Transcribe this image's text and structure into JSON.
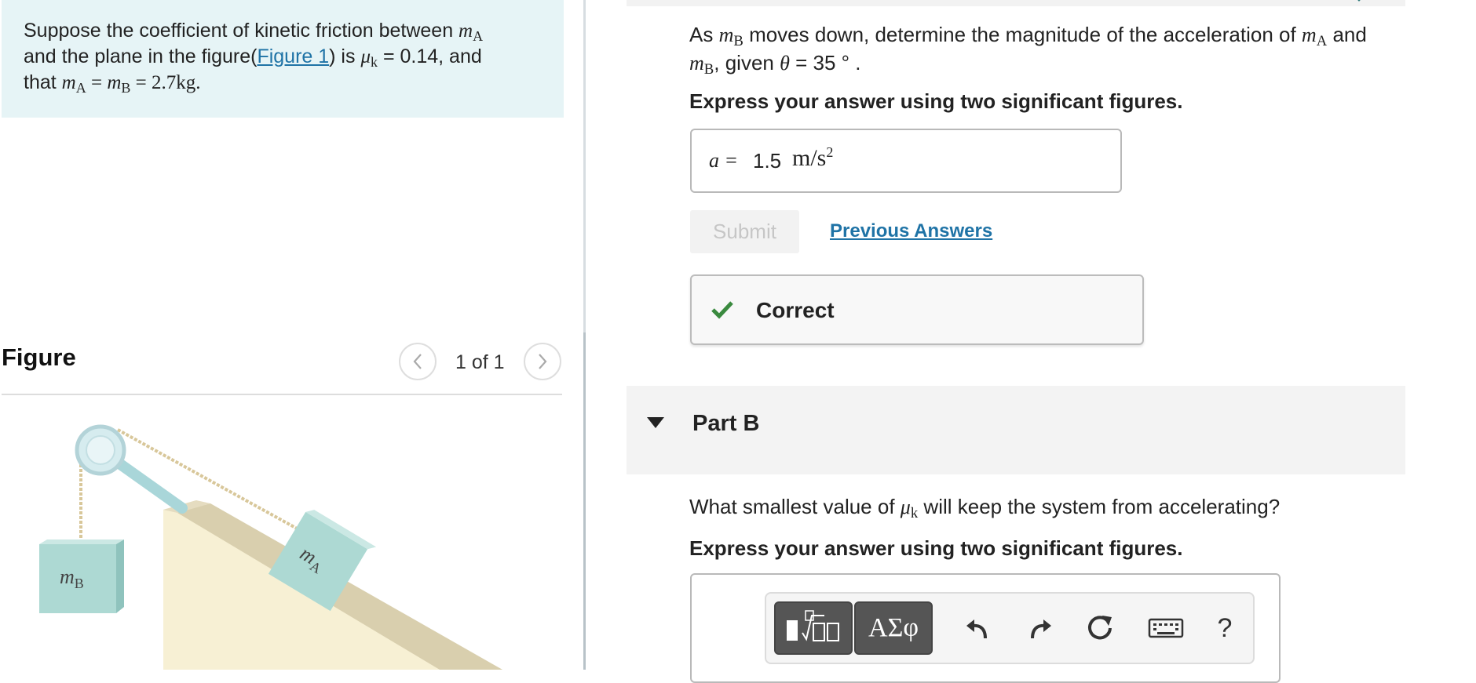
{
  "problem": {
    "text_1": "Suppose the coefficient of kinetic friction between ",
    "text_2": "and the plane in the figure(",
    "figure_link": "Figure 1",
    "text_3": ") is ",
    "text_4": " = 0.14, and",
    "text_5": "that ",
    "mass_value": "= 2.7kg."
  },
  "figure": {
    "title": "Figure",
    "counter": "1 of 1",
    "label_mb": "mB",
    "label_ma": "mA"
  },
  "part_a": {
    "question_1": "As ",
    "question_2": " moves down, determine the magnitude of the acceleration of ",
    "question_3": " and",
    "question_4": ", given ",
    "question_5": " = 35 ° .",
    "instructions": "Express your answer using two significant figures.",
    "answer_label": "a =",
    "answer_value": "1.5",
    "answer_unit": "m/s",
    "submit_label": "Submit",
    "previous_answers_label": "Previous Answers",
    "feedback": "Correct"
  },
  "part_b": {
    "title": "Part B",
    "question_1": "What smallest value of ",
    "question_2": " will keep the system from accelerating?",
    "instructions": "Express your answer using two significant figures."
  },
  "toolbar": {
    "greek_label": "ΑΣφ",
    "help_label": "?"
  },
  "colors": {
    "accent_link": "#1f73a6",
    "correct_green": "#3a8a3f",
    "problem_bg": "#e6f4f6"
  }
}
